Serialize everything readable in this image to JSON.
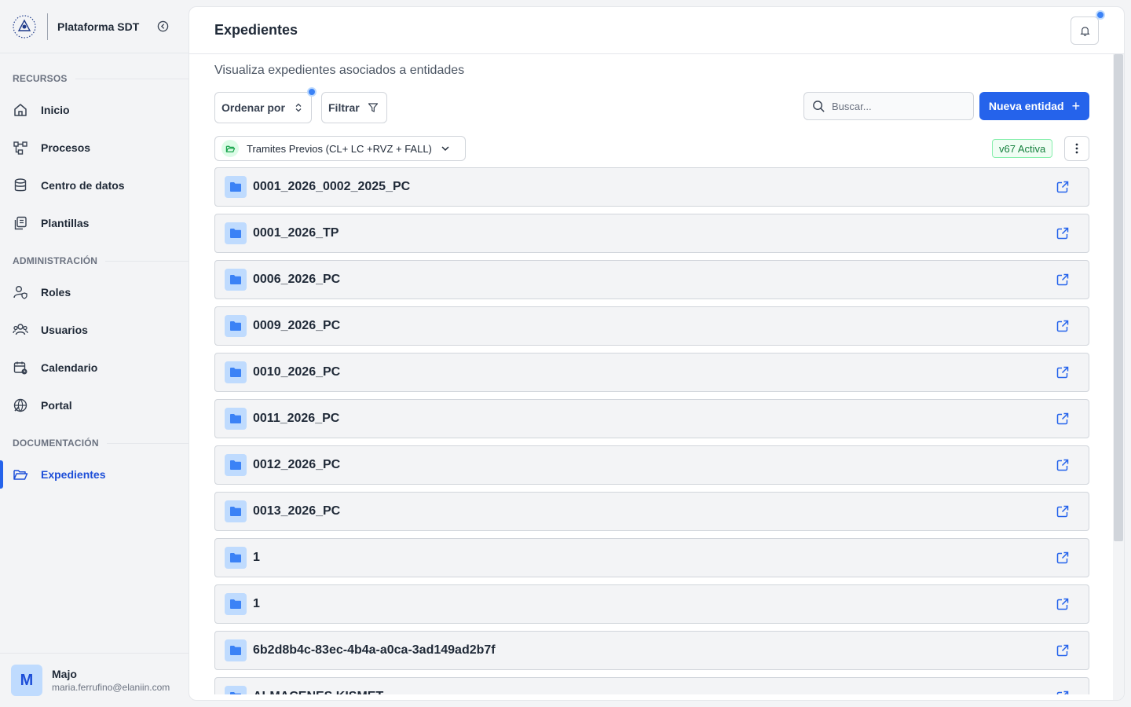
{
  "app": {
    "name": "Plataforma SDT"
  },
  "sidebar": {
    "sections": [
      {
        "title": "RECURSOS"
      },
      {
        "title": "ADMINISTRACIÓN"
      },
      {
        "title": "DOCUMENTACIÓN"
      }
    ],
    "items": [
      {
        "label": "Inicio",
        "icon": "home-icon"
      },
      {
        "label": "Procesos",
        "icon": "workflow-icon"
      },
      {
        "label": "Centro de datos",
        "icon": "database-icon"
      },
      {
        "label": "Plantillas",
        "icon": "templates-icon"
      },
      {
        "label": "Roles",
        "icon": "user-shield-icon"
      },
      {
        "label": "Usuarios",
        "icon": "users-icon"
      },
      {
        "label": "Calendario",
        "icon": "calendar-icon"
      },
      {
        "label": "Portal",
        "icon": "globe-icon"
      },
      {
        "label": "Expedientes",
        "icon": "folder-open-icon",
        "active": true
      }
    ]
  },
  "user": {
    "initial": "M",
    "name": "Majo",
    "email": "maria.ferrufino@elaniin.com"
  },
  "header": {
    "title": "Expedientes"
  },
  "main": {
    "subtitle": "Visualiza expedientes asociados a entidades",
    "sort_label": "Ordenar por",
    "filter_label": "Filtrar",
    "search_placeholder": "Buscar...",
    "new_button": "Nueva entidad",
    "entity_selector": "Tramites Previos (CL+ LC +RVZ + FALL)",
    "version_badge": "v67 Activa",
    "rows": [
      "0001_2026_0002_2025_PC",
      "0001_2026_TP",
      "0006_2026_PC",
      "0009_2026_PC",
      "0010_2026_PC",
      "0011_2026_PC",
      "0012_2026_PC",
      "0013_2026_PC",
      "1",
      "1",
      "6b2d8b4c-83ec-4b4a-a0ca-3ad149ad2b7f",
      "ALMACENES KISMET"
    ]
  },
  "colors": {
    "accent": "#2563eb",
    "active_text": "#1d4ed8",
    "badge_green": "#15803d"
  }
}
